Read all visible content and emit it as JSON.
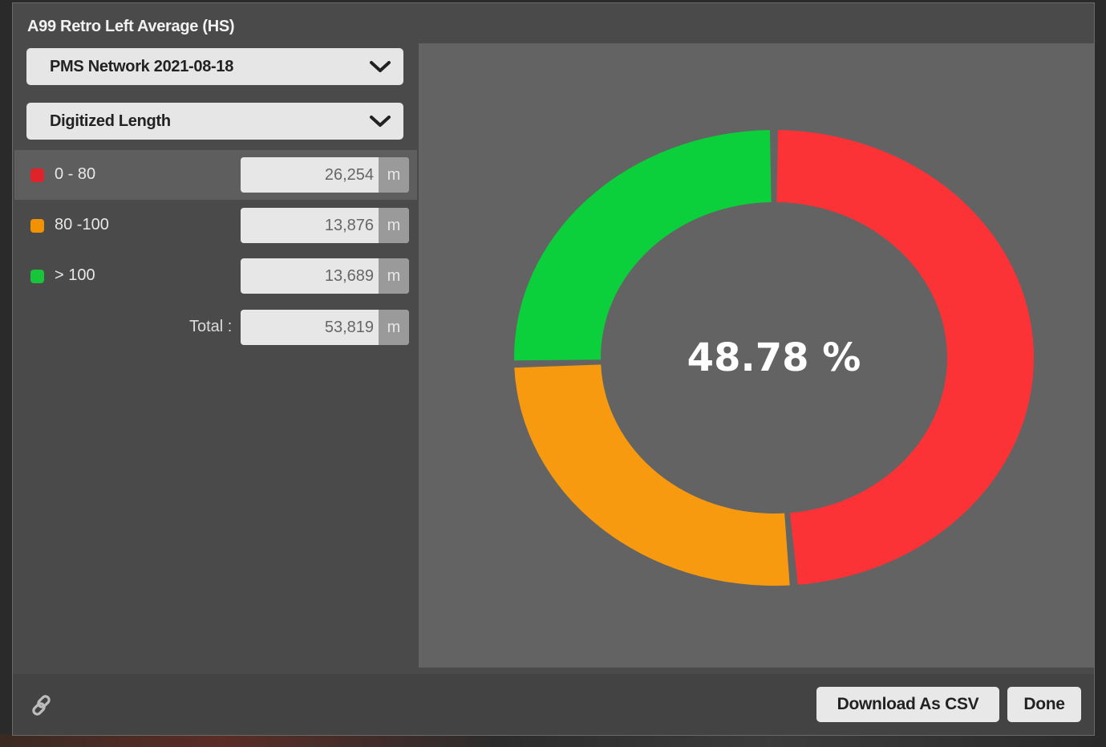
{
  "dialog": {
    "title": "A99 Retro Left Average (HS)",
    "dataset_select": "PMS Network 2021-08-18",
    "metric_select": "Digitized Length"
  },
  "legend": [
    {
      "label": "0 - 80",
      "value": "26,254",
      "unit": "m",
      "color": "#e0232b",
      "selected": true
    },
    {
      "label": "80 -100",
      "value": "13,876",
      "unit": "m",
      "color": "#f39200",
      "selected": false
    },
    {
      "label": "> 100",
      "value": "13,689",
      "unit": "m",
      "color": "#17c43a",
      "selected": false
    }
  ],
  "total": {
    "label": "Total :",
    "value": "53,819",
    "unit": "m"
  },
  "chart_data": {
    "type": "pie",
    "variant": "donut",
    "categories": [
      "0 - 80",
      "80 -100",
      "> 100"
    ],
    "values": [
      26254,
      13876,
      13689
    ],
    "colors": [
      "#fb3337",
      "#f89a10",
      "#0ccf3c"
    ],
    "center_label": "48.78 %"
  },
  "footer": {
    "link_icon": "link-icon",
    "download_label": "Download As CSV",
    "done_label": "Done"
  }
}
